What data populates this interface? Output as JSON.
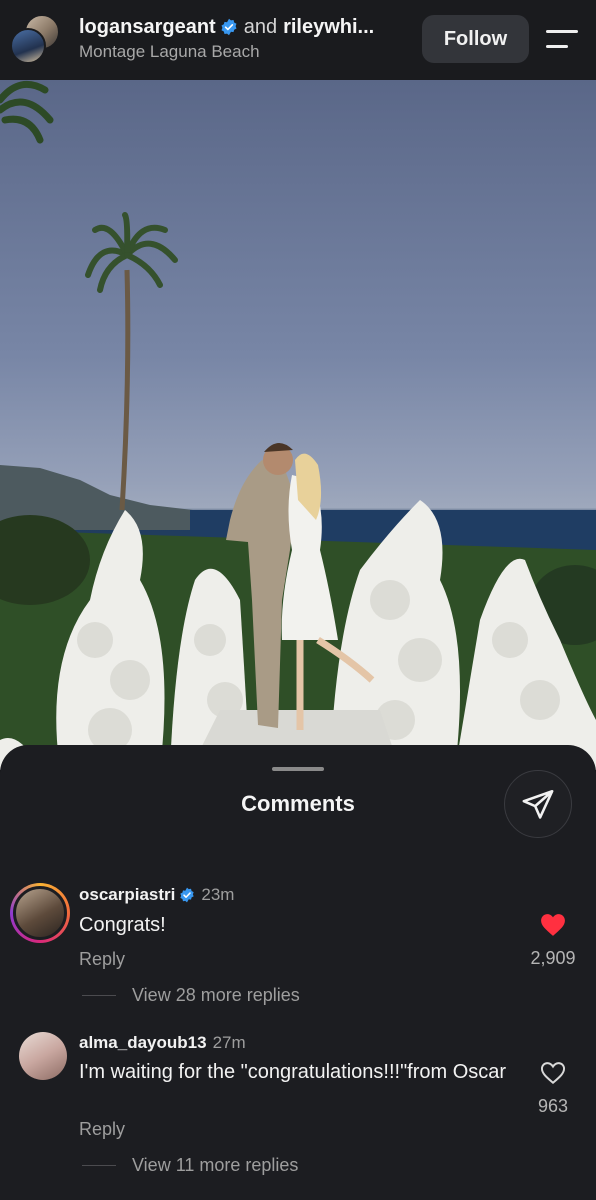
{
  "header": {
    "user1": "logansargeant",
    "and_text": "and",
    "user2": "rileywhi...",
    "location": "Montage Laguna Beach",
    "follow_label": "Follow"
  },
  "comments_sheet": {
    "title": "Comments"
  },
  "comments": [
    {
      "username": "oscarpiastri",
      "verified": true,
      "time": "23m",
      "text": "Congrats!",
      "reply_label": "Reply",
      "likes": "2,909",
      "liked": true,
      "more_replies": "View 28 more replies"
    },
    {
      "username": "alma_dayoub13",
      "verified": false,
      "time": "27m",
      "text": "I'm waiting for the \"congratulations!!!\"from Oscar",
      "reply_label": "Reply",
      "likes": "963",
      "liked": false,
      "more_replies": "View 11 more replies"
    }
  ],
  "colors": {
    "like_red": "#ff3040",
    "verified_blue": "#3897f0",
    "header_bg": "#1a1b1e",
    "sheet_bg": "#1c1d21"
  }
}
